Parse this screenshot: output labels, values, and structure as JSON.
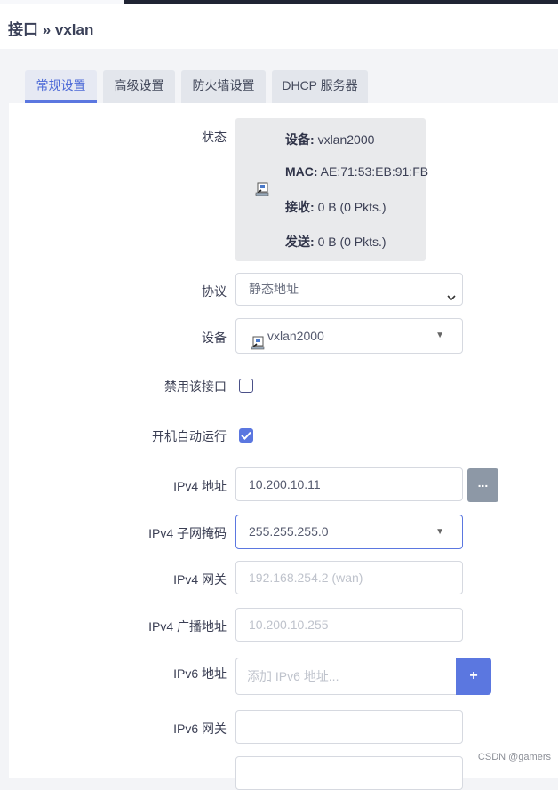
{
  "breadcrumb": {
    "title": "接口 » vxlan"
  },
  "tabs": [
    {
      "label": "常规设置",
      "active": true
    },
    {
      "label": "高级设置",
      "active": false
    },
    {
      "label": "防火墙设置",
      "active": false
    },
    {
      "label": "DHCP 服务器",
      "active": false
    }
  ],
  "status": {
    "label": "状态",
    "device_key": "设备:",
    "device_val": "vxlan2000",
    "mac_key": "MAC:",
    "mac_val": "AE:71:53:EB:91:FB",
    "rx_key": "接收:",
    "rx_val": "0 B (0 Pkts.)",
    "tx_key": "发送:",
    "tx_val": "0 B (0 Pkts.)"
  },
  "protocol": {
    "label": "协议",
    "value": "静态地址"
  },
  "device": {
    "label": "设备",
    "value": "vxlan2000"
  },
  "disable_iface": {
    "label": "禁用该接口",
    "checked": false
  },
  "autostart": {
    "label": "开机自动运行",
    "checked": true
  },
  "ipv4_addr": {
    "label": "IPv4 地址",
    "value": "10.200.10.11",
    "button": "..."
  },
  "ipv4_mask": {
    "label": "IPv4 子网掩码",
    "value": "255.255.255.0"
  },
  "ipv4_gw": {
    "label": "IPv4 网关",
    "placeholder": "192.168.254.2 (wan)"
  },
  "ipv4_bcast": {
    "label": "IPv4 广播地址",
    "placeholder": "10.200.10.255"
  },
  "ipv6_addr": {
    "label": "IPv6 地址",
    "placeholder": "添加 IPv6 地址...",
    "button": "+"
  },
  "ipv6_gw": {
    "label": "IPv6 网关",
    "value": ""
  },
  "watermark": "CSDN @gamers",
  "colors": {
    "accent": "#5b77e0",
    "secondary_button": "#8d98a6"
  }
}
